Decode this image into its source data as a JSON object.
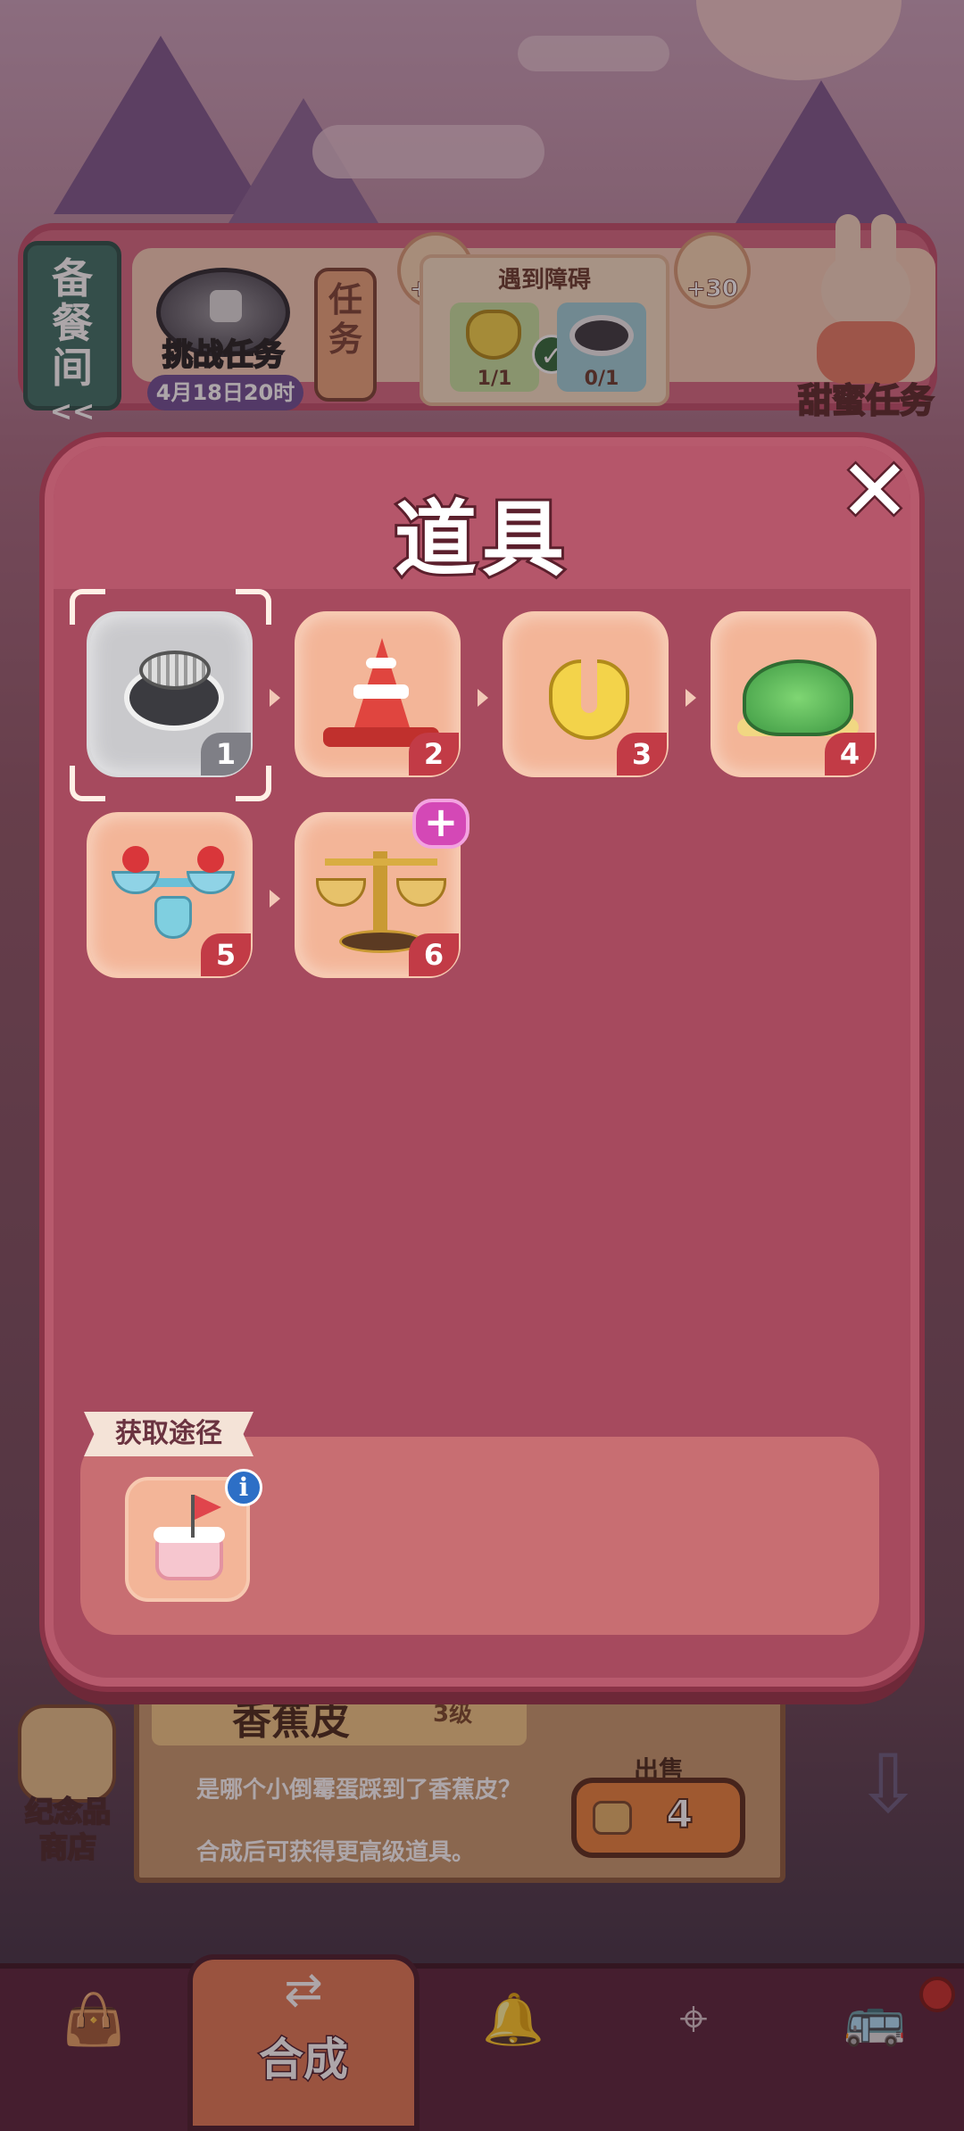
{
  "background": {
    "side_tab": {
      "label_line1": "备",
      "label_line2": "餐",
      "label_line3": "间",
      "arrow": "<<"
    },
    "challenge": {
      "title": "挑战任务",
      "date": "4月18日20时"
    },
    "task_button": {
      "label_line1": "任",
      "label_line2": "务"
    },
    "obstacle": {
      "title": "遇到障碍",
      "reward_left": "+10",
      "reward_right": "+30",
      "slots": [
        {
          "icon": "banana-peel-icon",
          "count": "1/1",
          "done": true
        },
        {
          "icon": "manhole-icon",
          "count": "0/1",
          "done": false
        }
      ]
    },
    "sweet_task_label": "甜蜜任务"
  },
  "modal": {
    "title": "道具",
    "close_icon": "close-icon",
    "items": [
      {
        "level": "1",
        "icon": "manhole-icon",
        "locked": true,
        "selected": true
      },
      {
        "level": "2",
        "icon": "traffic-cone-icon",
        "locked": false
      },
      {
        "level": "3",
        "icon": "banana-peel-icon",
        "locked": false
      },
      {
        "level": "4",
        "icon": "turtle-shell-icon",
        "locked": false
      },
      {
        "level": "5",
        "icon": "fruit-scale-icon",
        "locked": false
      },
      {
        "level": "6",
        "icon": "golden-scale-icon",
        "locked": false
      }
    ],
    "acquisition": {
      "label": "获取途径",
      "source_icon": "cake-flag-icon",
      "info_icon": "i"
    }
  },
  "item_info": {
    "name": "香蕉皮",
    "level": "3级",
    "description": "是哪个小倒霉蛋踩到了香蕉皮？",
    "hint": "合成后可获得更高级道具。",
    "sell_label": "出售",
    "sell_value": "4"
  },
  "souvenir_shop": {
    "label_line1": "纪念品",
    "label_line2": "商店"
  },
  "nav": {
    "active_label": "合成",
    "items": [
      "shop-bag-icon",
      "merge-icon",
      "cloche-icon",
      "map-icon",
      "bus-icon"
    ]
  },
  "colors": {
    "modal_bg": "#a64a5e",
    "accent_red": "#c23b46",
    "item_bg": "#f3b598"
  }
}
